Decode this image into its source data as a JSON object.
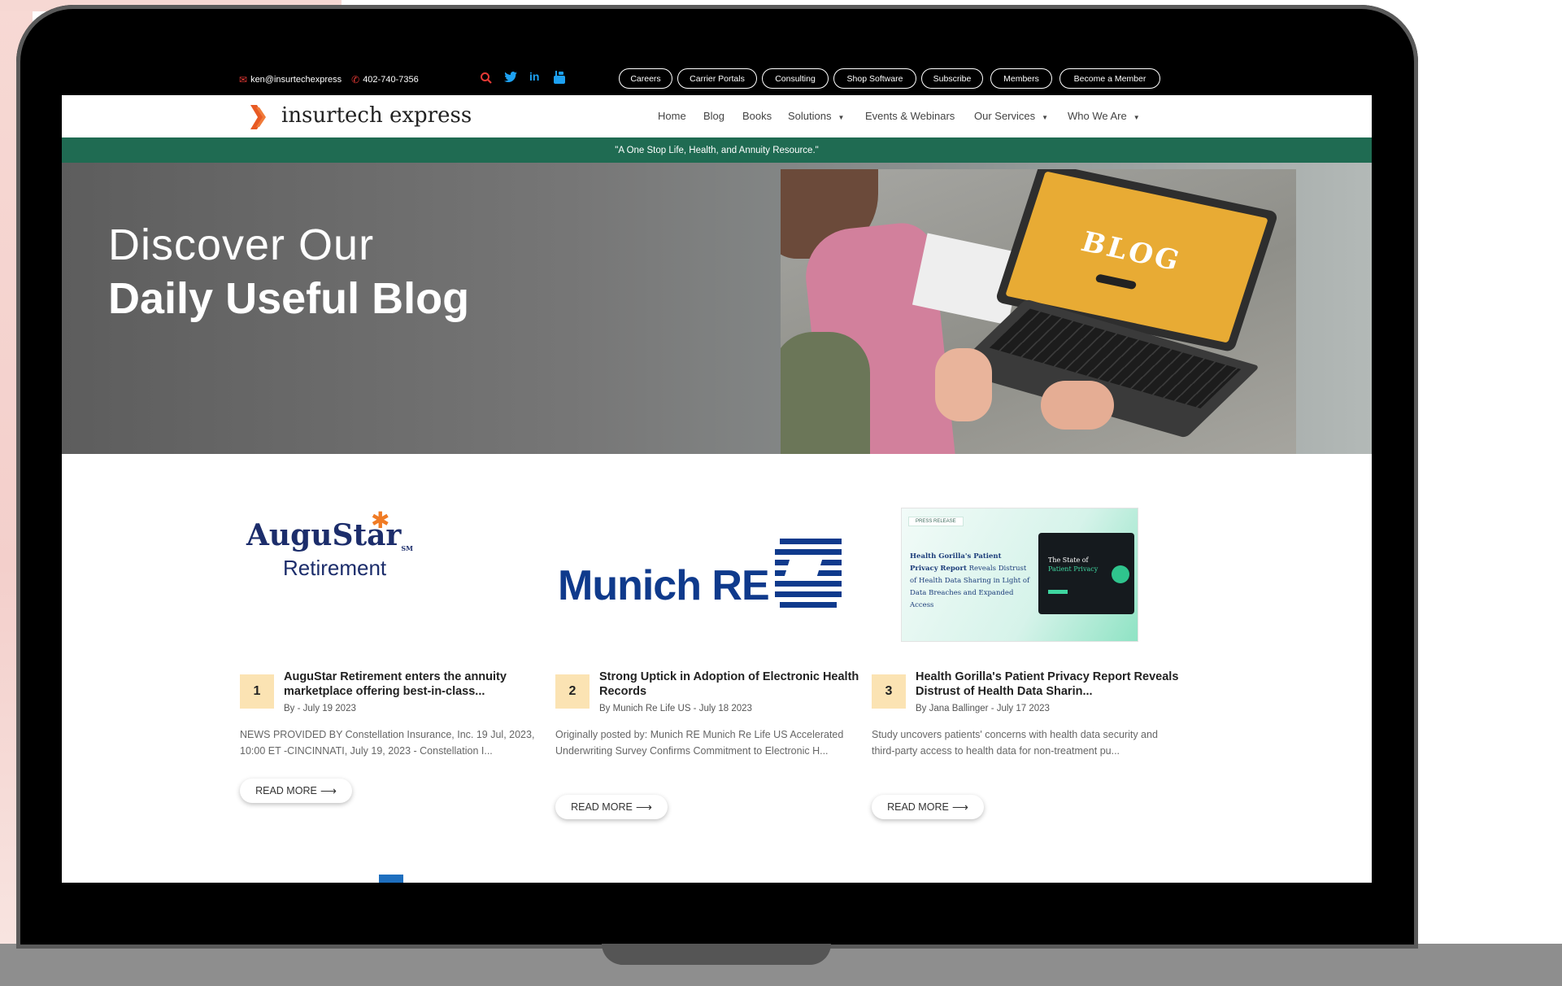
{
  "topbar": {
    "email": "ken@insurtechexpress",
    "phone": "402-740-7356",
    "email_icon": "envelope-icon",
    "phone_icon": "phone-icon",
    "search_icon": "search-icon",
    "social": [
      {
        "name": "twitter-icon",
        "glyph": "🐦"
      },
      {
        "name": "linkedin-icon",
        "glyph": "in"
      },
      {
        "name": "youtube-icon",
        "glyph": "▶"
      }
    ],
    "pills": [
      "Careers",
      "Carrier Portals",
      "Consulting",
      "Shop Software",
      "Subscribe",
      "Members",
      "Become a Member"
    ]
  },
  "header": {
    "logo_text": "insurtech express",
    "nav": [
      {
        "label": "Home",
        "caret": false
      },
      {
        "label": "Blog",
        "caret": false
      },
      {
        "label": "Books",
        "caret": false
      },
      {
        "label": "Solutions",
        "caret": true
      },
      {
        "label": "Events & Webinars",
        "caret": false
      },
      {
        "label": "Our Services",
        "caret": true
      },
      {
        "label": "Who We Are",
        "caret": true
      }
    ],
    "caret_glyph": "▼"
  },
  "tagline": "\"A One Stop Life, Health, and Annuity Resource.\"",
  "hero": {
    "line1": "Discover Our",
    "line2": "Daily Useful Blog",
    "screen_word": "BLOG"
  },
  "posts": [
    {
      "number": "1",
      "logo_line1": "AuguStar",
      "logo_line2": "Retirement",
      "logo_tm": "SM",
      "title": "AuguStar Retirement enters the annuity marketplace offering best-in-class...",
      "meta": "By - July 19 2023",
      "excerpt": "NEWS PROVIDED BY Constellation Insurance, Inc. 19 Jul, 2023, 10:00 ET -CINCINNATI, July 19, 2023 - Constellation I...",
      "read_more": "READ MORE"
    },
    {
      "number": "2",
      "logo_line1": "Munich RE",
      "title": "Strong Uptick in Adoption of Electronic Health Records",
      "meta": "By Munich Re Life US - July 18 2023",
      "excerpt": "Originally posted by: Munich RE Munich Re Life US Accelerated Underwriting Survey Confirms Commitment to Electronic H...",
      "read_more": "READ MORE"
    },
    {
      "number": "3",
      "press_label": "PRESS RELEASE",
      "press_headline_bold1": "Health Gorilla's Patient Privacy",
      "press_headline_bold2": "Report",
      "press_headline_rest": "Reveals Distrust of Health Data Sharing in Light of Data Breaches and Expanded Access",
      "press_screen_title1": "The State of",
      "press_screen_title2": "Patient Privacy",
      "title": "Health Gorilla's Patient Privacy Report Reveals Distrust of Health Data Sharin...",
      "meta": "By Jana Ballinger - July 17 2023",
      "excerpt": "Study uncovers patients' concerns with health data security and third-party access to health data for non-treatment pu...",
      "read_more": "READ MORE"
    }
  ],
  "arrow_glyph": "⟶"
}
